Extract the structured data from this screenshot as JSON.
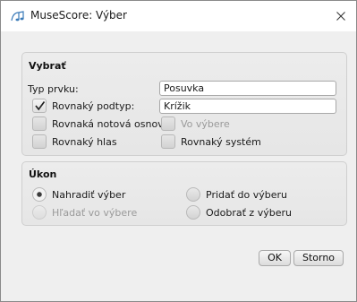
{
  "window": {
    "title": "MuseScore: Výber",
    "icon": "musescore-icon",
    "close_icon": "close-icon"
  },
  "select_group": {
    "title": "Vybrať",
    "type_label": "Typ prvku:",
    "type_value": "Posuvka",
    "same_subtype": {
      "label": "Rovnaký podtyp:",
      "checked": true
    },
    "subtype_value": "Krížik",
    "same_staff": {
      "label": "Rovnaká notová osnova",
      "checked": false
    },
    "in_selection": {
      "label": "Vo výbere",
      "checked": false,
      "enabled": false
    },
    "same_voice": {
      "label": "Rovnaký hlas",
      "checked": false
    },
    "same_system": {
      "label": "Rovnaký systém",
      "checked": false
    }
  },
  "action_group": {
    "title": "Úkon",
    "replace_selection": {
      "label": "Nahradiť výber",
      "checked": true
    },
    "add_to_selection": {
      "label": "Pridať do výberu",
      "checked": false
    },
    "search_in_selection": {
      "label": "Hľadať vo výbere",
      "checked": false,
      "enabled": false
    },
    "remove_from_selection": {
      "label": "Odobrať z výberu",
      "checked": false
    }
  },
  "buttons": {
    "ok": "OK",
    "cancel": "Storno"
  }
}
